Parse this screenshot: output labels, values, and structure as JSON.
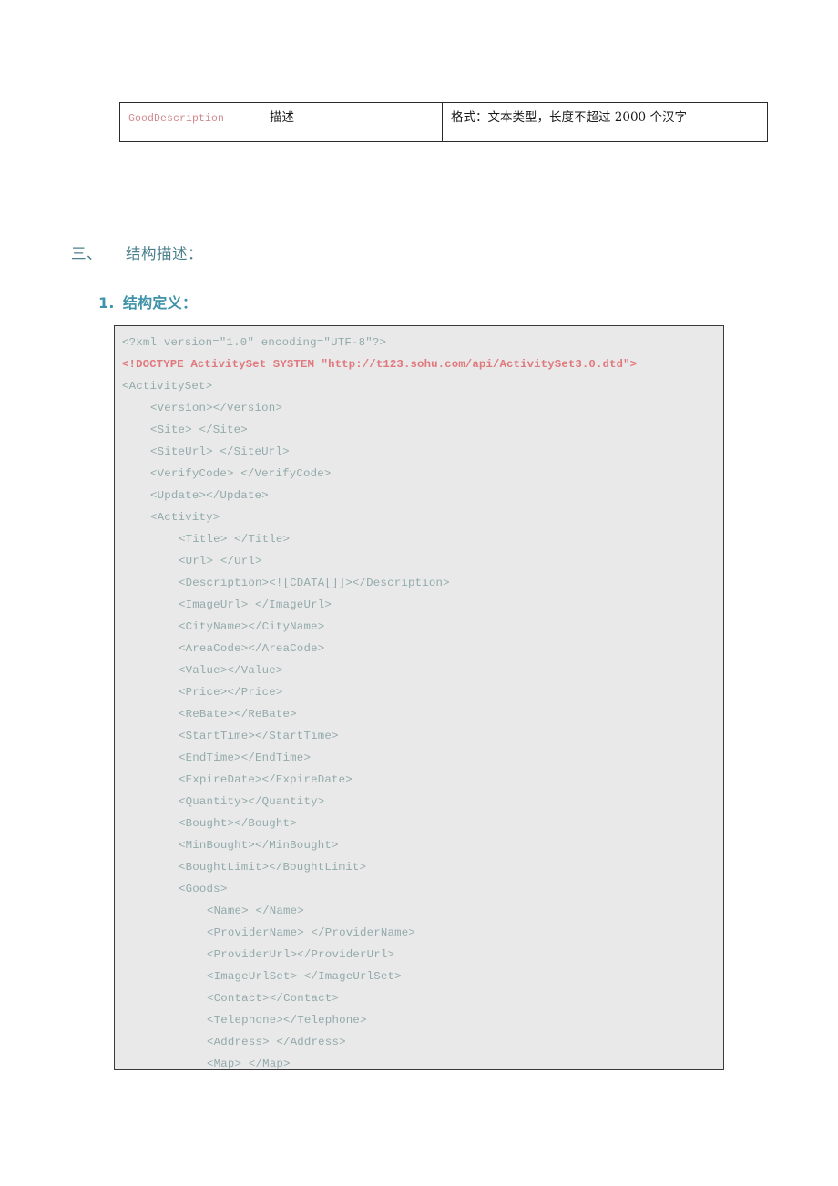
{
  "table": {
    "rows": [
      {
        "field": "GoodDescription",
        "name": "描述",
        "description": "格式：文本类型，长度不超过 2000 个汉字"
      }
    ]
  },
  "headings": {
    "section_number": "三、",
    "section_title": "结构描述：",
    "sub_number": "1.",
    "sub_title": "结构定义："
  },
  "code_block": {
    "lines": [
      {
        "indent": 0,
        "text": "<?xml version=\"1.0\" encoding=\"UTF-8\"?>",
        "style": "normal"
      },
      {
        "indent": 0,
        "text": "<!DOCTYPE ActivitySet SYSTEM \"http://t123.sohu.com/api/ActivitySet3.0.dtd\">",
        "style": "doctype"
      },
      {
        "indent": 0,
        "text": "<ActivitySet>",
        "style": "normal"
      },
      {
        "indent": 1,
        "text": "<Version></Version>",
        "style": "normal"
      },
      {
        "indent": 1,
        "text": "<Site> </Site>",
        "style": "normal"
      },
      {
        "indent": 1,
        "text": "<SiteUrl> </SiteUrl>",
        "style": "normal"
      },
      {
        "indent": 1,
        "text": "<VerifyCode> </VerifyCode>",
        "style": "normal"
      },
      {
        "indent": 1,
        "text": "<Update></Update>",
        "style": "normal"
      },
      {
        "indent": 1,
        "text": "<Activity>",
        "style": "normal"
      },
      {
        "indent": 2,
        "text": "<Title> </Title>",
        "style": "normal"
      },
      {
        "indent": 2,
        "text": "<Url> </Url>",
        "style": "normal"
      },
      {
        "indent": 2,
        "text": "<Description><![CDATA[]]></Description>",
        "style": "normal"
      },
      {
        "indent": 2,
        "text": "<ImageUrl> </ImageUrl>",
        "style": "normal"
      },
      {
        "indent": 2,
        "text": "<CityName></CityName>",
        "style": "normal"
      },
      {
        "indent": 2,
        "text": "<AreaCode></AreaCode>",
        "style": "normal"
      },
      {
        "indent": 2,
        "text": "<Value></Value>",
        "style": "normal"
      },
      {
        "indent": 2,
        "text": "<Price></Price>",
        "style": "normal"
      },
      {
        "indent": 2,
        "text": "<ReBate></ReBate>",
        "style": "normal"
      },
      {
        "indent": 2,
        "text": "<StartTime></StartTime>",
        "style": "normal"
      },
      {
        "indent": 2,
        "text": "<EndTime></EndTime>",
        "style": "normal"
      },
      {
        "indent": 2,
        "text": "<ExpireDate></ExpireDate>",
        "style": "normal"
      },
      {
        "indent": 2,
        "text": "<Quantity></Quantity>",
        "style": "normal"
      },
      {
        "indent": 2,
        "text": "<Bought></Bought>",
        "style": "normal"
      },
      {
        "indent": 2,
        "text": "<MinBought></MinBought>",
        "style": "normal"
      },
      {
        "indent": 2,
        "text": "<BoughtLimit></BoughtLimit>",
        "style": "normal"
      },
      {
        "indent": 2,
        "text": "<Goods>",
        "style": "normal"
      },
      {
        "indent": 3,
        "text": "<Name> </Name>",
        "style": "normal"
      },
      {
        "indent": 3,
        "text": "<ProviderName> </ProviderName>",
        "style": "normal"
      },
      {
        "indent": 3,
        "text": "<ProviderUrl></ProviderUrl>",
        "style": "normal"
      },
      {
        "indent": 3,
        "text": "<ImageUrlSet> </ImageUrlSet>",
        "style": "normal"
      },
      {
        "indent": 3,
        "text": "<Contact></Contact>",
        "style": "normal"
      },
      {
        "indent": 3,
        "text": "<Telephone></Telephone>",
        "style": "normal"
      },
      {
        "indent": 3,
        "text": "<Address> </Address>",
        "style": "normal"
      },
      {
        "indent": 3,
        "text": "<Map> </Map>",
        "style": "normal"
      }
    ]
  }
}
